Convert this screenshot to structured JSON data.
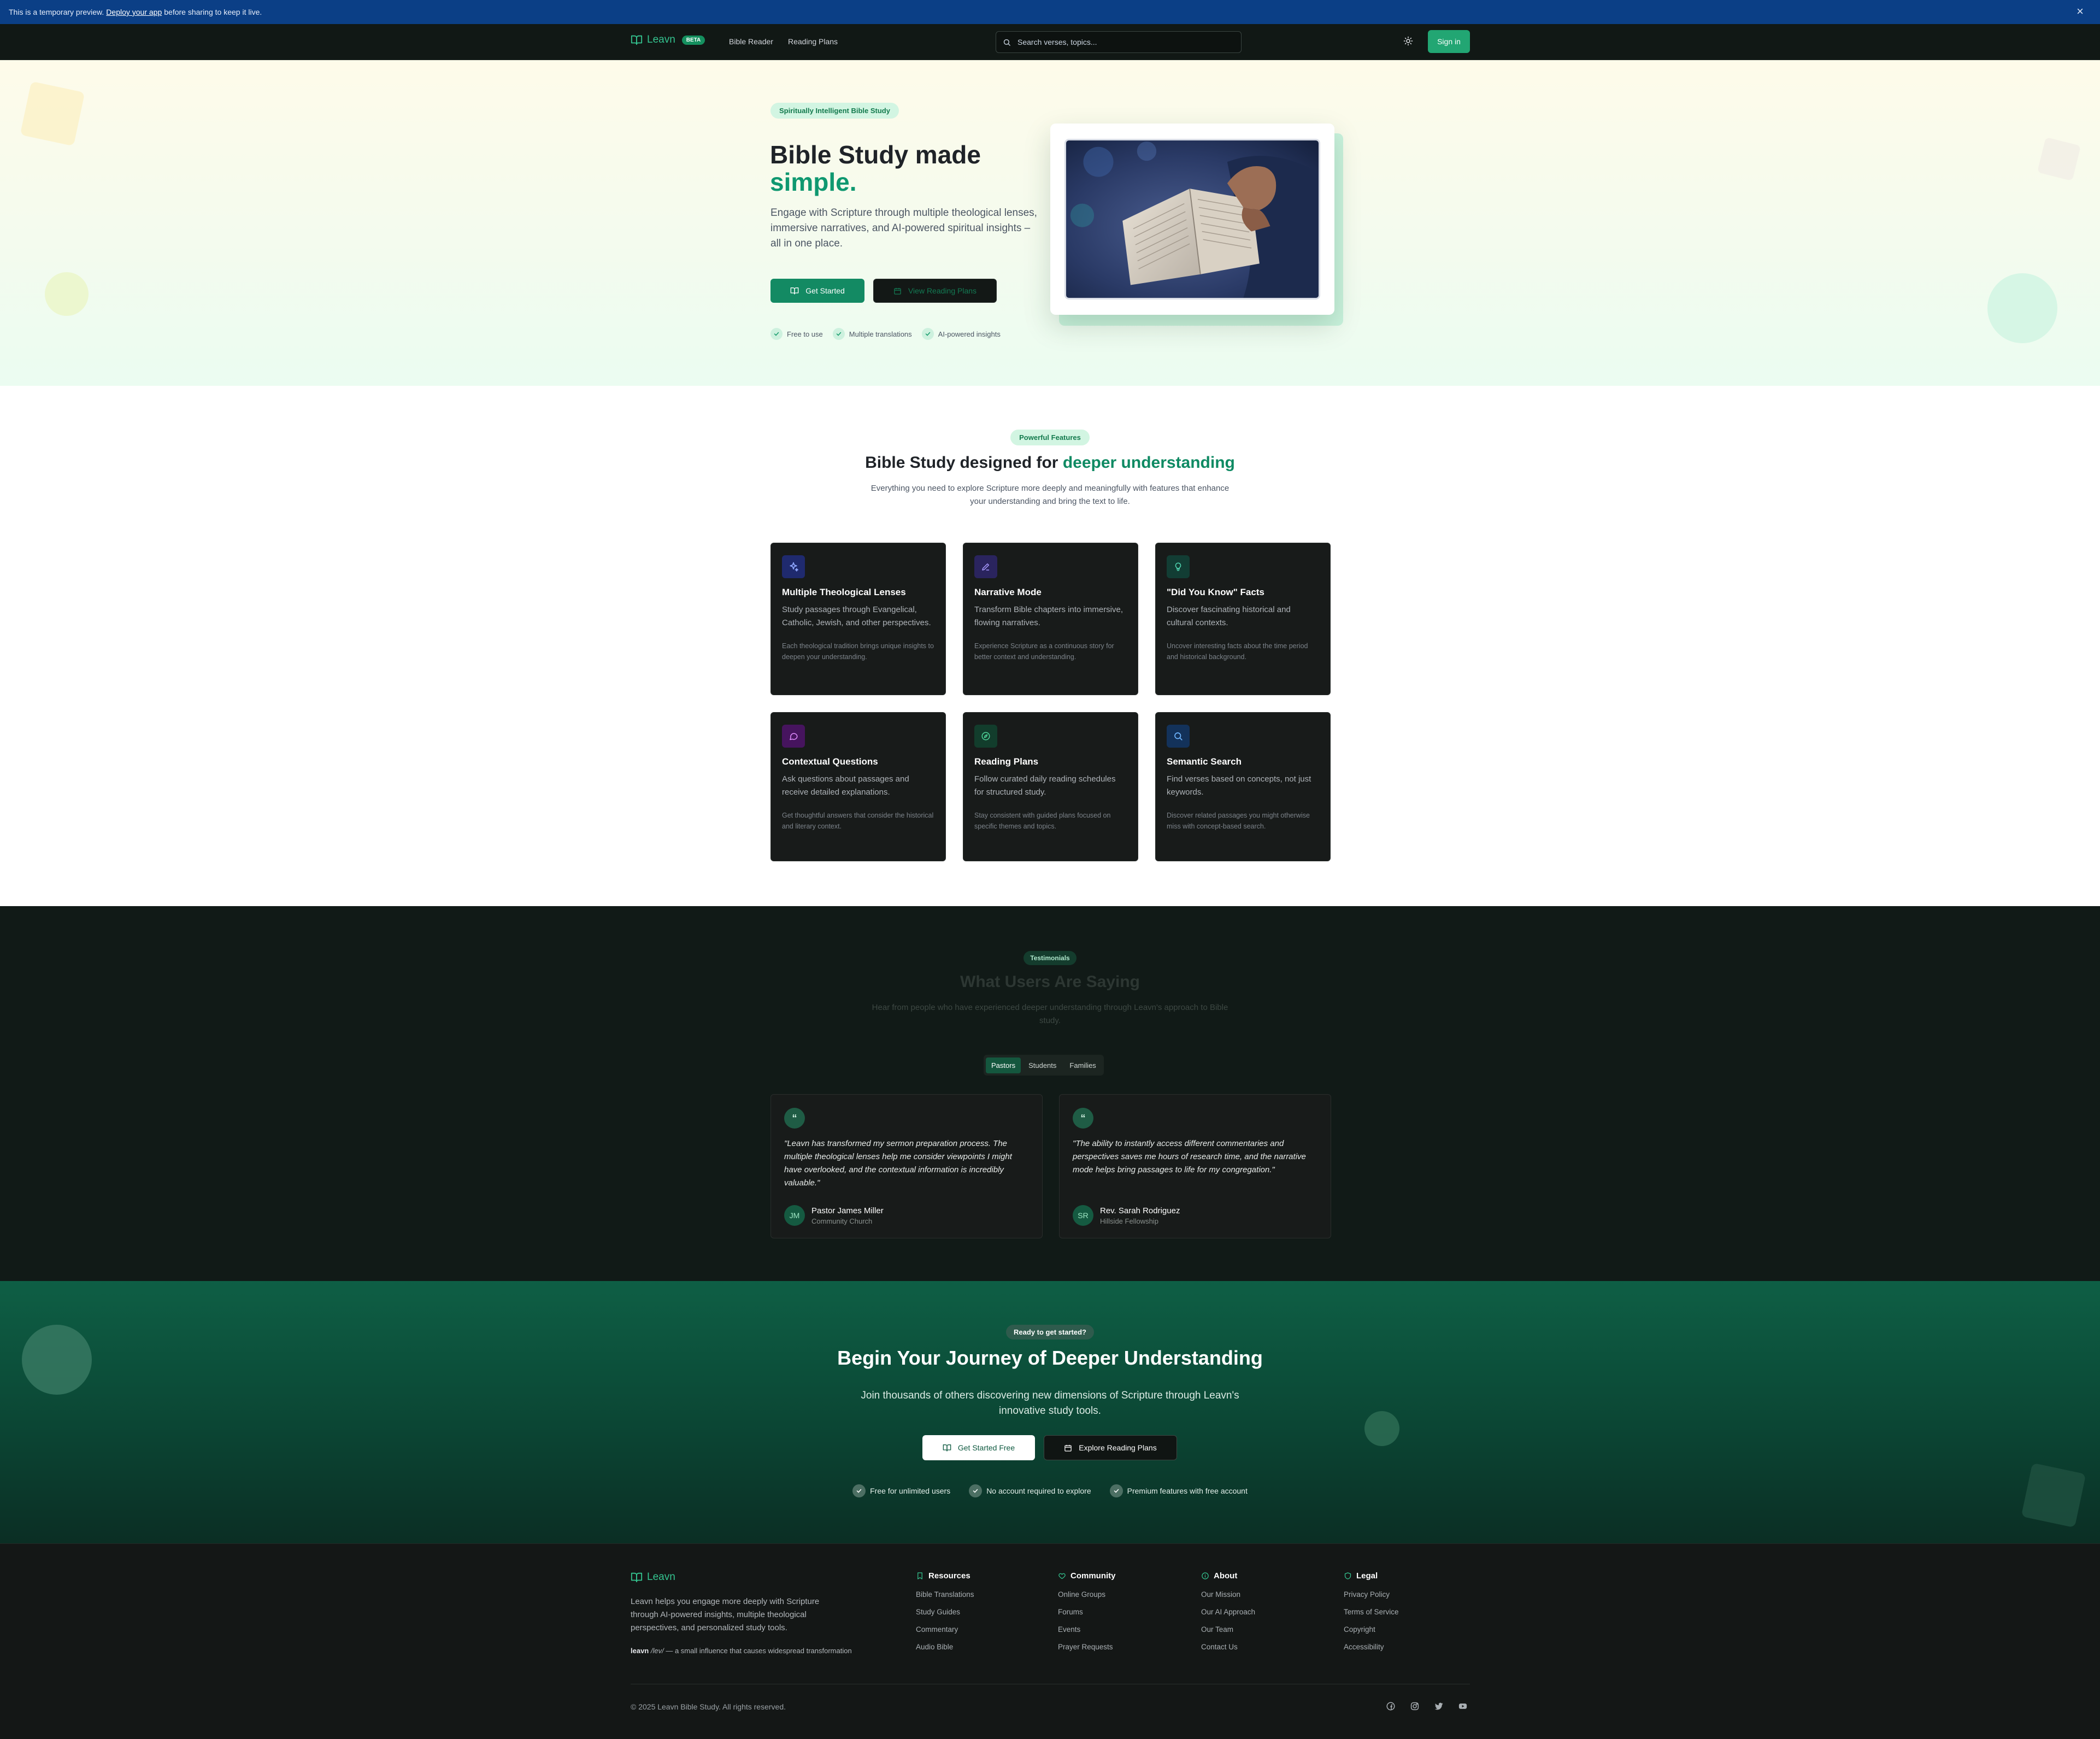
{
  "preview_bar": {
    "text_before": "This is a temporary preview.",
    "link": "Deploy your app",
    "text_after": "before sharing to keep it live.",
    "close": "×"
  },
  "nav": {
    "brand": "Leavn",
    "badge": "BETA",
    "links": [
      "Bible Reader",
      "Reading Plans"
    ],
    "search_placeholder": "Search verses, topics...",
    "signin": "Sign in"
  },
  "hero": {
    "pill": "Spiritually Intelligent Bible Study",
    "title_line1": "Bible Study made",
    "title_line2": "simple.",
    "subtitle": "Engage with Scripture through multiple theological lenses, immersive narratives, and AI-powered spiritual insights – all in one place.",
    "cta_primary": "Get Started",
    "cta_secondary": "View Reading Plans",
    "checks": [
      "Free to use",
      "Multiple translations",
      "AI-powered insights"
    ]
  },
  "features": {
    "pill": "Powerful Features",
    "title_start": "Bible Study designed for",
    "title_accent": "deeper understanding",
    "subtitle": "Everything you need to explore Scripture more deeply and meaningfully with features that enhance your understanding and bring the text to life.",
    "cards": [
      {
        "icon": "sparkles-icon",
        "title": "Multiple Theological Lenses",
        "desc": "Study passages through Evangelical, Catholic, Jewish, and other perspectives.",
        "note": "Each theological tradition brings unique insights to deepen your understanding."
      },
      {
        "icon": "pen-icon",
        "title": "Narrative Mode",
        "desc": "Transform Bible chapters into immersive, flowing narratives.",
        "note": "Experience Scripture as a continuous story for better context and understanding."
      },
      {
        "icon": "lightbulb-icon",
        "title": "\"Did You Know\" Facts",
        "desc": "Discover fascinating historical and cultural contexts.",
        "note": "Uncover interesting facts about the time period and historical background."
      },
      {
        "icon": "message-circle-icon",
        "title": "Contextual Questions",
        "desc": "Ask questions about passages and receive detailed explanations.",
        "note": "Get thoughtful answers that consider the historical and literary context."
      },
      {
        "icon": "compass-icon",
        "title": "Reading Plans",
        "desc": "Follow curated daily reading schedules for structured study.",
        "note": "Stay consistent with guided plans focused on specific themes and topics."
      },
      {
        "icon": "search-icon",
        "title": "Semantic Search",
        "desc": "Find verses based on concepts, not just keywords.",
        "note": "Discover related passages you might otherwise miss with concept-based search."
      }
    ]
  },
  "testimonials": {
    "pill": "Testimonials",
    "title": "What Users Are Saying",
    "subtitle": "Hear from people who have experienced deeper understanding through Leavn's approach to Bible study.",
    "tabs": [
      "Pastors",
      "Students",
      "Families"
    ],
    "active_tab": "Pastors",
    "items": [
      {
        "quote": "\"Leavn has transformed my sermon preparation process. The multiple theological lenses help me consider viewpoints I might have overlooked, and the contextual information is incredibly valuable.\"",
        "initials": "JM",
        "name": "Pastor James Miller",
        "org": "Community Church"
      },
      {
        "quote": "\"The ability to instantly access different commentaries and perspectives saves me hours of research time, and the narrative mode helps bring passages to life for my congregation.\"",
        "initials": "SR",
        "name": "Rev. Sarah Rodriguez",
        "org": "Hillside Fellowship"
      }
    ]
  },
  "cta": {
    "pill": "Ready to get started?",
    "title": "Begin Your Journey of Deeper Understanding",
    "subtitle": "Join thousands of others discovering new dimensions of Scripture through Leavn's innovative study tools.",
    "btn_primary": "Get Started Free",
    "btn_secondary": "Explore Reading Plans",
    "checks": [
      "Free for unlimited users",
      "No account required to explore",
      "Premium features with free account"
    ]
  },
  "footer": {
    "brand": "Leavn",
    "description": "Leavn helps you engage more deeply with Scripture through AI-powered insights, multiple theological perspectives, and personalized study tools.",
    "tag_word": "leavn",
    "tag_pron": "/lev/",
    "tag_rest": "— a small influence that causes widespread transformation",
    "columns": [
      {
        "icon": "bookmark-icon",
        "title": "Resources",
        "links": [
          "Bible Translations",
          "Study Guides",
          "Commentary",
          "Audio Bible"
        ]
      },
      {
        "icon": "heart-icon",
        "title": "Community",
        "links": [
          "Online Groups",
          "Forums",
          "Events",
          "Prayer Requests"
        ]
      },
      {
        "icon": "info-icon",
        "title": "About",
        "links": [
          "Our Mission",
          "Our AI Approach",
          "Our Team",
          "Contact Us"
        ]
      },
      {
        "icon": "shield-icon",
        "title": "Legal",
        "links": [
          "Privacy Policy",
          "Terms of Service",
          "Copyright",
          "Accessibility"
        ]
      }
    ],
    "copyright": "© 2025 Leavn Bible Study. All rights reserved.",
    "socials": [
      "facebook-icon",
      "instagram-icon",
      "twitter-icon",
      "youtube-icon"
    ]
  },
  "colors": {
    "brand_green": "#0f9870",
    "preview_blue": "#0b3f86",
    "dark_bg": "#111815",
    "card_bg": "#181b1a"
  }
}
